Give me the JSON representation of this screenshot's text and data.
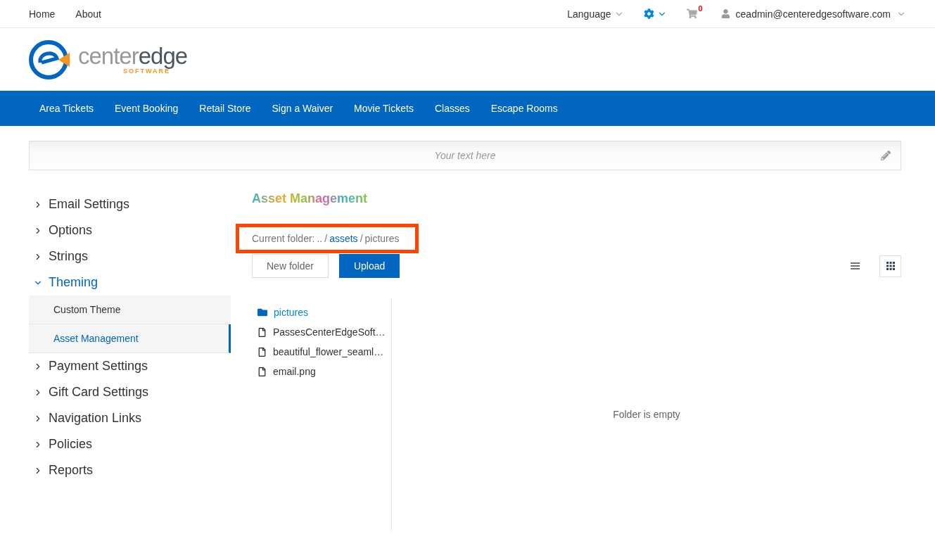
{
  "top_nav": {
    "links": [
      "Home",
      "About"
    ],
    "language": "Language",
    "cart_count": "0",
    "user": "ceadmin@centeredgesoftware.com"
  },
  "logo": {
    "name_parts": [
      "center",
      "edge"
    ],
    "tagline": "SOFTWARE"
  },
  "main_nav": [
    "Area Tickets",
    "Event Booking",
    "Retail Store",
    "Sign a Waiver",
    "Movie Tickets",
    "Classes",
    "Escape Rooms"
  ],
  "banner": {
    "placeholder": "Your text here"
  },
  "sidebar": {
    "items": [
      {
        "label": "Email Settings",
        "expanded": false
      },
      {
        "label": "Options",
        "expanded": false
      },
      {
        "label": "Strings",
        "expanded": false
      },
      {
        "label": "Theming",
        "expanded": true,
        "children": [
          {
            "label": "Custom Theme",
            "selected": false
          },
          {
            "label": "Asset Management",
            "selected": true
          }
        ]
      },
      {
        "label": "Payment Settings",
        "expanded": false
      },
      {
        "label": "Gift Card Settings",
        "expanded": false
      },
      {
        "label": "Navigation Links",
        "expanded": false
      },
      {
        "label": "Policies",
        "expanded": false
      },
      {
        "label": "Reports",
        "expanded": false
      }
    ]
  },
  "content": {
    "title": "Asset Management",
    "current_folder": {
      "label": "Current folder:",
      "path": [
        {
          "text": "..",
          "kind": "link"
        },
        {
          "text": "assets",
          "kind": "link"
        },
        {
          "text": "pictures",
          "kind": "current"
        }
      ],
      "separator": "/",
      "highlighted": true
    },
    "buttons": [
      {
        "label": "New folder",
        "kind": "secondary"
      },
      {
        "label": "Upload",
        "kind": "primary"
      }
    ],
    "views": [
      {
        "kind": "list",
        "selected": false
      },
      {
        "kind": "grid",
        "selected": true
      }
    ],
    "files": [
      {
        "name": "pictures",
        "kind": "folder"
      },
      {
        "name": "PassesCenterEdgeSoft…",
        "kind": "file"
      },
      {
        "name": "beautiful_flower_seaml…",
        "kind": "file"
      },
      {
        "name": "email.png",
        "kind": "file"
      }
    ],
    "empty_message": "Folder is empty"
  }
}
